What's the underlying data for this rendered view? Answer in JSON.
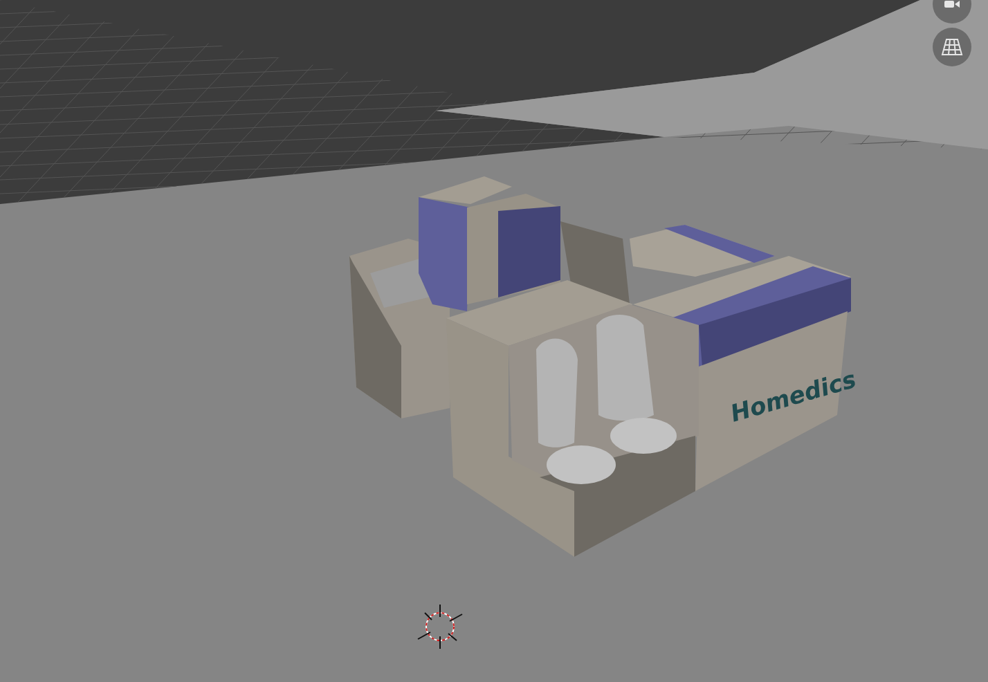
{
  "viewport": {
    "model_label": "Homedics"
  },
  "nav_buttons": [
    {
      "kind": "camera"
    },
    {
      "kind": "grid"
    }
  ]
}
